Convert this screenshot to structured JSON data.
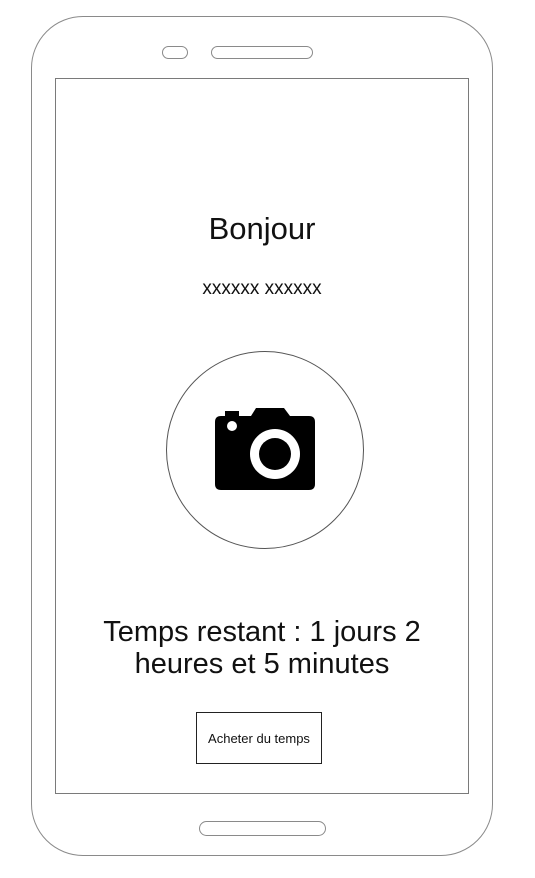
{
  "screen": {
    "greeting": "Bonjour",
    "user_name": "xxxxxx xxxxxx",
    "avatar": {
      "icon": "camera-icon"
    },
    "time_remaining": "Temps restant : 1 jours 2 heures et 5 minutes",
    "buy_button_label": "Acheter du temps"
  },
  "colors": {
    "frame": "#8a8a8a",
    "text": "#111111",
    "background": "#ffffff"
  }
}
